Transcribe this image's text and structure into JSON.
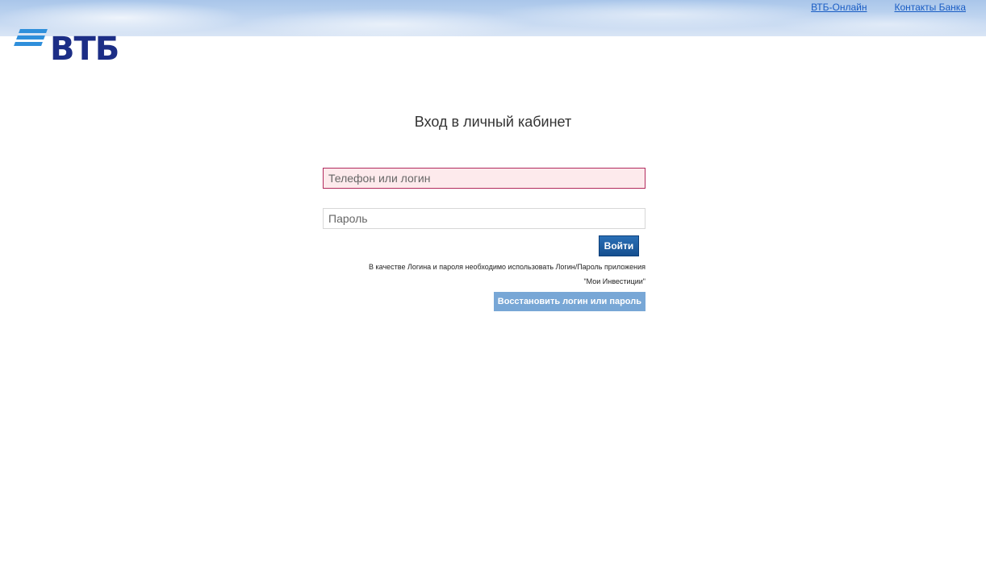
{
  "header": {
    "links": [
      {
        "label": "ВТБ-Онлайн"
      },
      {
        "label": "Контакты Банка"
      }
    ]
  },
  "logo": {
    "text": "ВТБ",
    "icon": "vtb-stripes-logo",
    "color": "#1c2e86"
  },
  "login_form": {
    "title": "Вход в личный кабинет",
    "login_placeholder": "Телефон или логин",
    "login_value": "",
    "password_placeholder": "Пароль",
    "password_value": "",
    "submit_label": "Войти",
    "note_line1": "В качестве Логина и пароля необходимо использовать Логин/Пароль приложения",
    "note_line2": "\"Мои Инвестиции\"",
    "recover_label": "Восстановить логин или пароль"
  },
  "colors": {
    "accent": "#154f8f",
    "error_border": "#b22a5d",
    "error_background": "#fdeaec",
    "recover_button": "#78a7d6",
    "link": "#1a5dc4"
  }
}
